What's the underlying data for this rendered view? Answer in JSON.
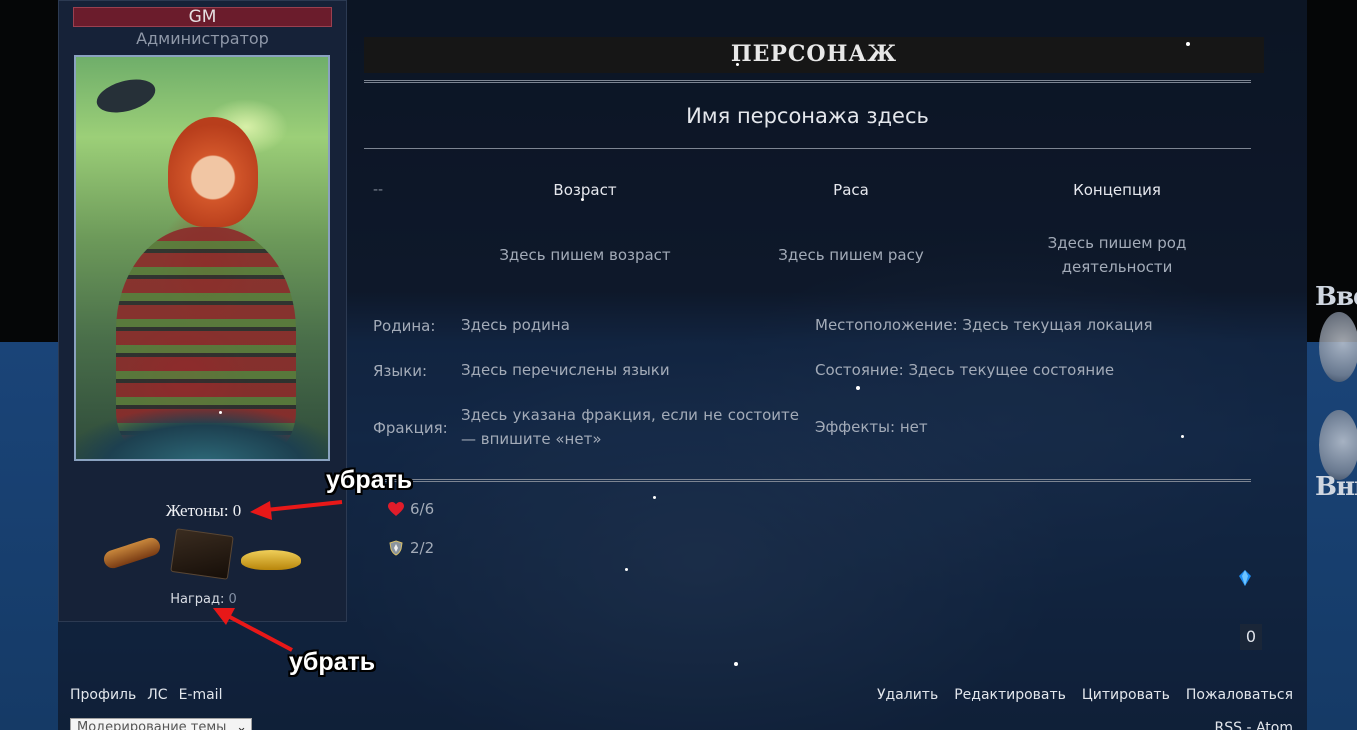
{
  "profile": {
    "username": "GM",
    "rank": "Администратор",
    "tokens_label": "Жетоны: 0",
    "rewards_label": "Наград:",
    "rewards_count": "0"
  },
  "post": {
    "header": "ПЕРСОНАЖ",
    "character_name": "Имя персонажа здесь",
    "dash": "--",
    "columns": [
      {
        "head": "Возраст",
        "value": "Здесь пишем возраст"
      },
      {
        "head": "Раса",
        "value": "Здесь пишем расу"
      },
      {
        "head": "Концепция",
        "value": "Здесь пишем род деятельности"
      }
    ],
    "rows": {
      "homeland_label": "Родина:",
      "homeland_value": "Здесь родина",
      "languages_label": "Языки:",
      "languages_value": "Здесь перечислены языки",
      "faction_label": "Фракция:",
      "faction_value": "Здесь указана фракция, если не состоите — впишите «нет»",
      "location": "Местоположение: Здесь текущая локация",
      "state": "Состояние: Здесь текущее состояние",
      "effects": "Эффекты: нет"
    },
    "stats": {
      "health": "6/6",
      "defense": "2/2"
    },
    "counter": "0"
  },
  "footer": {
    "left_links": [
      "Профиль",
      "ЛС",
      "E-mail"
    ],
    "right_links": [
      "Удалить",
      "Редактировать",
      "Цитировать",
      "Пожаловаться"
    ],
    "moderation_select": "Модерирование темы",
    "rss": "RSS - Atom"
  },
  "annotations": {
    "note_1": "убрать",
    "note_2": "убрать"
  },
  "side_text": {
    "top": "Вве",
    "bottom": "Вни"
  },
  "colors": {
    "username_bg": "#6b1c2c",
    "header_bg": "#161616",
    "arrow": "#e81818",
    "heart": "#e01c2a"
  }
}
